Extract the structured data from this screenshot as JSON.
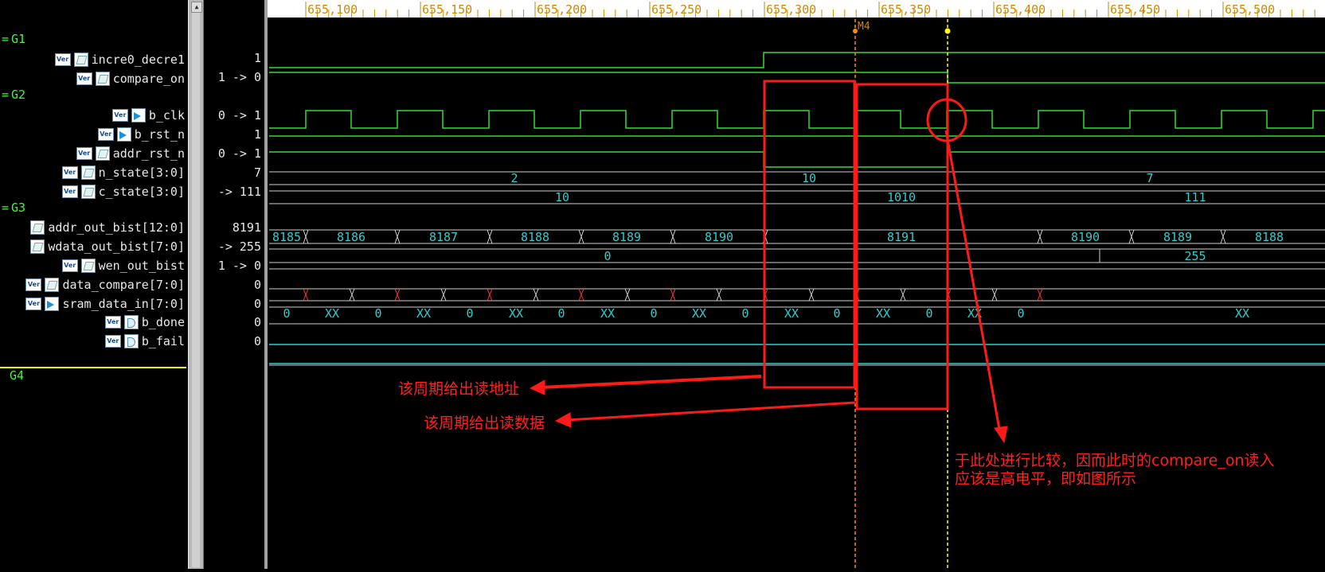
{
  "signals": [
    {
      "group": "G1",
      "items": [
        {
          "name": "incre0_decre1",
          "icon": "internal",
          "value": "1"
        },
        {
          "name": "compare_on",
          "icon": "internal",
          "value": "1 -> 0"
        }
      ]
    },
    {
      "group": "G2",
      "items": [
        {
          "name": "b_clk",
          "icon": "input",
          "value": "0 -> 1"
        },
        {
          "name": "b_rst_n",
          "icon": "input",
          "value": "1"
        },
        {
          "name": "addr_rst_n",
          "icon": "internal",
          "value": "0 -> 1"
        },
        {
          "name": "n_state[3:0]",
          "icon": "internal",
          "value": "7"
        },
        {
          "name": "c_state[3:0]",
          "icon": "internal",
          "value": "-> 111"
        }
      ]
    },
    {
      "group": "G3",
      "items": [
        {
          "name": "addr_out_bist[12:0]",
          "icon": "internal",
          "value": "8191"
        },
        {
          "name": "wdata_out_bist[7:0]",
          "icon": "internal",
          "value": "-> 255"
        },
        {
          "name": "wen_out_bist",
          "icon": "internal",
          "value": "1 -> 0"
        },
        {
          "name": "data_compare[7:0]",
          "icon": "internal",
          "value": "0"
        },
        {
          "name": "sram_data_in[7:0]",
          "icon": "input",
          "value": "0"
        },
        {
          "name": "b_done",
          "icon": "output",
          "value": "0"
        },
        {
          "name": "b_fail",
          "icon": "output",
          "value": "0"
        }
      ]
    },
    {
      "group": "G4",
      "items": []
    }
  ],
  "icon_text": {
    "ver": "Ver"
  },
  "timeline": {
    "ticks": [
      "655,100",
      "655,150",
      "655,200",
      "655,250",
      "655,300",
      "655,350",
      "655,400",
      "655,450",
      "655,500"
    ],
    "marker_label": "M4"
  },
  "bus_labels": {
    "n_state": [
      "2",
      "10",
      "7"
    ],
    "c_state": [
      "10",
      "1010",
      "111"
    ],
    "addr": [
      "8185",
      "8186",
      "8187",
      "8188",
      "8189",
      "8190",
      "8191",
      "8190",
      "8189",
      "8188"
    ],
    "wdata": [
      "0",
      "255"
    ],
    "sram": [
      "0",
      "XX",
      "0",
      "XX",
      "0",
      "XX",
      "0",
      "XX",
      "0",
      "XX",
      "0",
      "XX",
      "0",
      "XX",
      "0",
      "XX",
      "0",
      "XX"
    ]
  },
  "annotations": {
    "read_address": "该周期给出读地址",
    "read_data": "该周期给出读数据",
    "compare_line1": "于此处进行比较，因而此时的compare_on读入",
    "compare_line2": "应该是高电平，即如图所示"
  },
  "colors": {
    "group": "#33ff33",
    "wave_high": "#33dd33",
    "wave_low": "#33cccc",
    "marker": "#ff8c00",
    "cursor": "#ffff00",
    "annotation": "#ff2020"
  }
}
